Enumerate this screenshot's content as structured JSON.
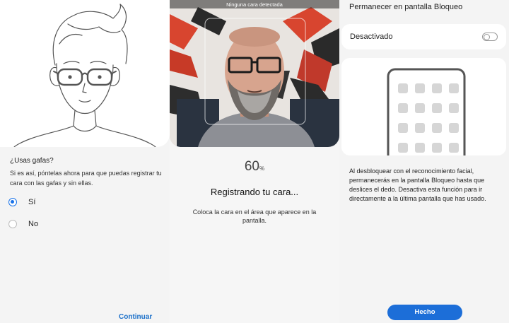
{
  "glasses_screen": {
    "question": "¿Usas gafas?",
    "description": "Si es así, póntelas ahora para que puedas registrar tu cara con las gafas y sin ellas.",
    "options": [
      {
        "label": "Sí",
        "selected": true
      },
      {
        "label": "No",
        "selected": false
      }
    ],
    "continue_label": "Continuar"
  },
  "register_screen": {
    "camera_status": "Ninguna cara detectada",
    "progress_value": "60",
    "progress_unit": "%",
    "title": "Registrando tu cara...",
    "instruction": "Coloca la cara en el área que aparece en la pantalla."
  },
  "lock_screen": {
    "title": "Permanecer en pantalla Bloqueo",
    "toggle_label": "Desactivado",
    "toggle_on": false,
    "description": "Al desbloquear con el reconocimiento facial, permanecerás en la pantalla Bloqueo hasta que deslices el dedo. Desactiva esta función para ir directamente a la última pantalla que has usado.",
    "done_label": "Hecho"
  },
  "colors": {
    "accent": "#1a73e8",
    "button": "#1c6ed8",
    "link": "#1a6fc9"
  }
}
